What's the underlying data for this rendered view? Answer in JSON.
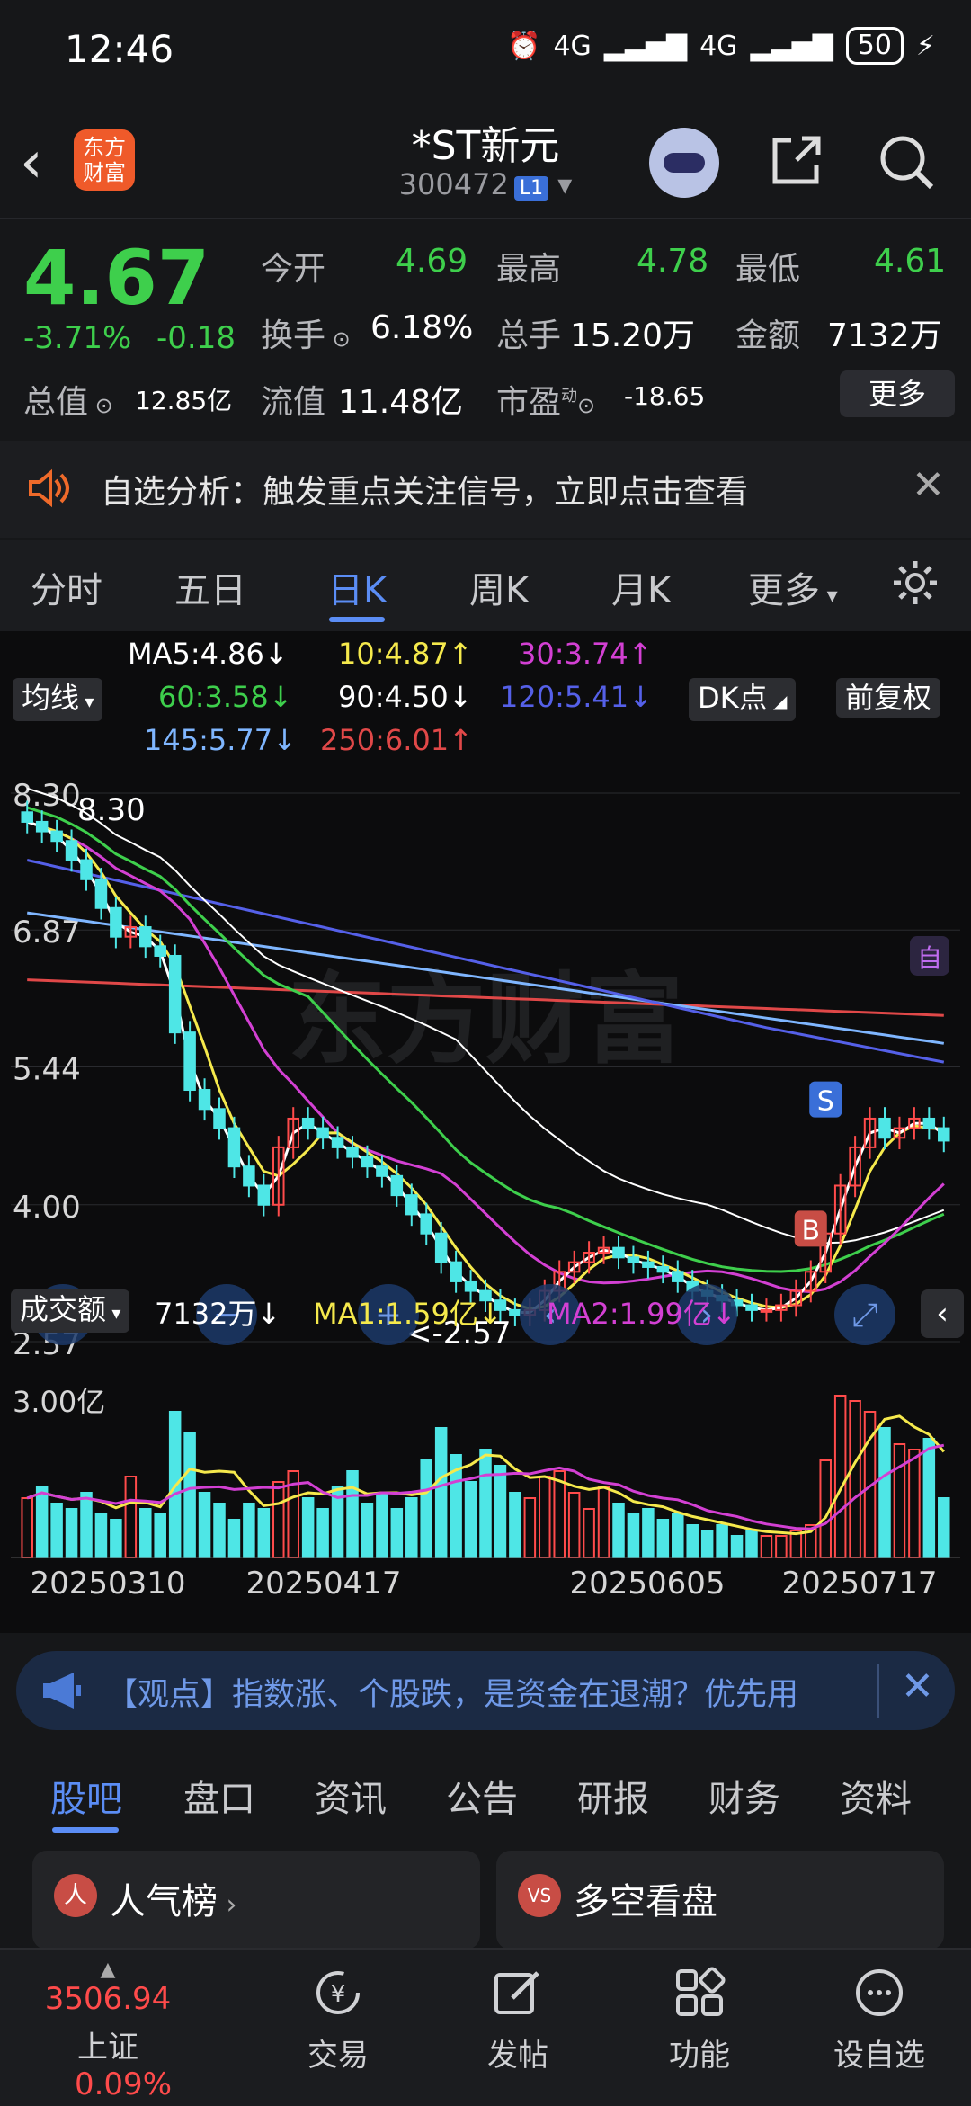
{
  "status_bar": {
    "time": "12:46",
    "network1": "4G",
    "network2": "4G",
    "battery": "50"
  },
  "header": {
    "logo_text": "东方财富",
    "stock_name": "*ST新元",
    "stock_code": "300472",
    "level_badge": "L1"
  },
  "quote": {
    "price": "4.67",
    "change_pct": "-3.71%",
    "change": "-0.18",
    "open_label": "今开",
    "open": "4.69",
    "high_label": "最高",
    "high": "4.78",
    "low_label": "最低",
    "low": "4.61",
    "turnover_label": "换手",
    "turnover": "6.18%",
    "volume_label": "总手",
    "volume": "15.20万",
    "amount_label": "金额",
    "amount": "7132万",
    "total_value_label": "总值",
    "total_value": "12.85亿",
    "float_value_label": "流值",
    "float_value": "11.48亿",
    "pe_label": "市盈",
    "pe_sup": "动",
    "pe": "-18.65",
    "more": "更多"
  },
  "notice": {
    "text": "自选分析：触发重点关注信号，立即点击查看"
  },
  "kline_tabs": [
    {
      "label": "分时"
    },
    {
      "label": "五日"
    },
    {
      "label": "日K"
    },
    {
      "label": "周K"
    },
    {
      "label": "月K"
    },
    {
      "label": "更多"
    }
  ],
  "chart_controls": {
    "ma_select": "均线",
    "dk": "DK点",
    "adjust": "前复权",
    "vol_select": "成交额",
    "side_badge": "自"
  },
  "ma_legend": {
    "ma5": "MA5:4.86",
    "ma10": "10:4.87",
    "ma30": "30:3.74",
    "ma60": "60:3.58",
    "ma90": "90:4.50",
    "ma120": "120:5.41",
    "ma145": "145:5.77",
    "ma250": "250:6.01"
  },
  "vol_legend": {
    "value": "7132万",
    "ma1": "MA1:1.59亿",
    "ma2": "MA2:1.99亿"
  },
  "chart_data": {
    "type": "candlestick",
    "y_ticks": [
      "8.30",
      "6.87",
      "5.44",
      "4.00",
      "2.57"
    ],
    "ylim": [
      2.57,
      8.3
    ],
    "high_marker": "8.30",
    "low_marker": "<-2.57",
    "x_ticks": [
      "20250310",
      "20250417",
      "20250605",
      "20250717"
    ],
    "signals": [
      "S",
      "B"
    ],
    "vol_tick": "3.00亿",
    "watermark": "东方财富",
    "close_series": [
      8.0,
      7.9,
      7.8,
      7.6,
      7.4,
      7.1,
      6.8,
      6.9,
      6.7,
      6.6,
      5.8,
      5.2,
      5.0,
      4.8,
      4.4,
      4.2,
      4.0,
      4.6,
      4.9,
      4.8,
      4.7,
      4.6,
      4.5,
      4.4,
      4.3,
      4.1,
      3.9,
      3.7,
      3.4,
      3.2,
      3.1,
      3.0,
      2.9,
      2.85,
      2.9,
      3.1,
      3.3,
      3.4,
      3.5,
      3.55,
      3.45,
      3.4,
      3.35,
      3.3,
      3.2,
      3.1,
      3.05,
      3.0,
      2.95,
      2.9,
      2.9,
      2.95,
      3.1,
      3.3,
      3.7,
      4.2,
      4.6,
      4.9,
      4.7,
      4.8,
      4.9,
      4.8,
      4.67
    ],
    "volume_series": [
      1.1,
      1.3,
      1.0,
      0.9,
      1.2,
      0.8,
      0.7,
      1.5,
      0.9,
      0.8,
      2.7,
      2.3,
      1.2,
      1.0,
      0.7,
      1.0,
      0.9,
      1.4,
      1.6,
      1.1,
      0.9,
      1.3,
      1.6,
      1.0,
      1.2,
      0.9,
      1.1,
      1.8,
      2.4,
      1.9,
      1.4,
      2.0,
      1.7,
      1.2,
      1.1,
      1.5,
      1.6,
      1.2,
      0.9,
      1.3,
      1.0,
      0.8,
      0.9,
      0.7,
      0.8,
      0.6,
      0.5,
      0.6,
      0.4,
      0.5,
      0.4,
      0.4,
      0.5,
      0.6,
      1.8,
      3.0,
      2.9,
      2.7,
      2.4,
      2.1,
      2.0,
      2.2,
      1.1
    ]
  },
  "banner": {
    "text": "【观点】指数涨、个股跌，是资金在退潮？优先用"
  },
  "bottom_tabs": [
    {
      "label": "股吧"
    },
    {
      "label": "盘口"
    },
    {
      "label": "资讯"
    },
    {
      "label": "公告"
    },
    {
      "label": "研报"
    },
    {
      "label": "财务"
    },
    {
      "label": "资料"
    }
  ],
  "cards": [
    {
      "icon": "人",
      "title": "人气榜"
    },
    {
      "icon": "VS",
      "title": "多空看盘"
    }
  ],
  "bottom_nav": {
    "index_value": "3506.94",
    "index_name": "上证",
    "index_change": "0.09%",
    "items": [
      {
        "label": "交易"
      },
      {
        "label": "发帖"
      },
      {
        "label": "功能"
      },
      {
        "label": "设自选"
      }
    ]
  }
}
